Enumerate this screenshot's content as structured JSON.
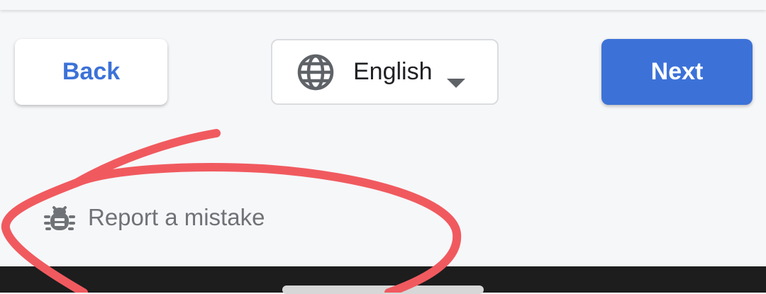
{
  "navigation": {
    "back_label": "Back",
    "next_label": "Next"
  },
  "language": {
    "selected": "English",
    "icon": "globe-icon",
    "dropdown_icon": "caret-down-icon"
  },
  "report": {
    "label": "Report a mistake",
    "icon": "bug-icon"
  },
  "colors": {
    "accent": "#3c72d8",
    "back_text": "#3c72d8",
    "annotation": "#f05a5f",
    "system_bar": "#1d1d1d"
  }
}
